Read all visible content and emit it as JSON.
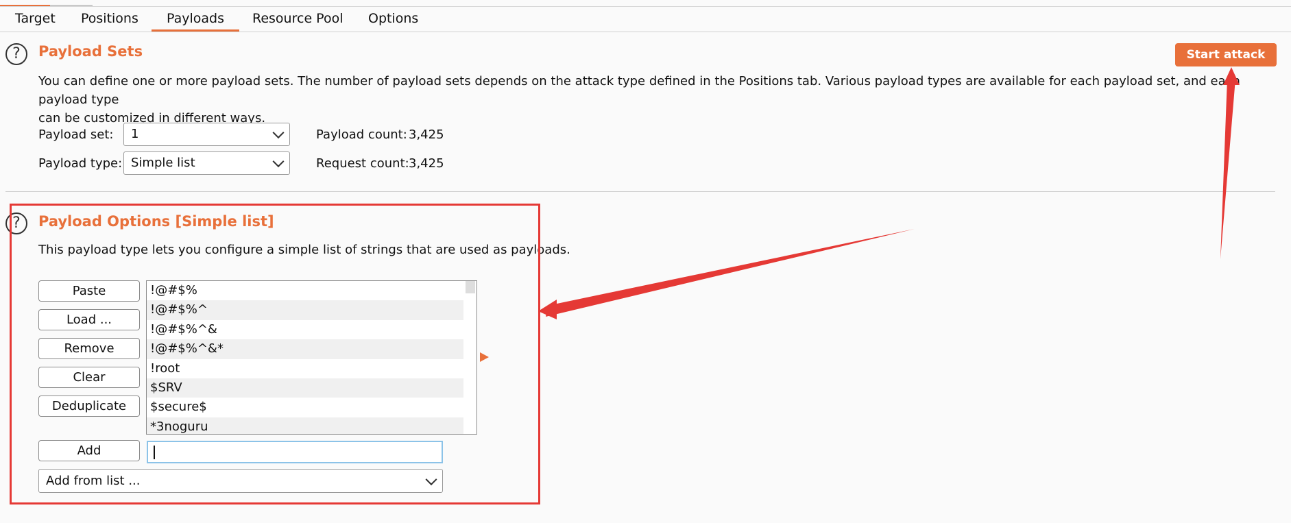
{
  "tabs": [
    "Target",
    "Positions",
    "Payloads",
    "Resource Pool",
    "Options"
  ],
  "active_tab": "Payloads",
  "payload_sets": {
    "title": "Payload Sets",
    "description_line1": "You can define one or more payload sets. The number of payload sets depends on the attack type defined in the Positions tab. Various payload types are available for each payload set, and each payload type",
    "description_line2": "can be customized in different ways.",
    "set_label": "Payload set:",
    "set_value": "1",
    "type_label": "Payload type:",
    "type_value": "Simple list",
    "payload_count_label": "Payload count:",
    "payload_count_value": "3,425",
    "request_count_label": "Request count:",
    "request_count_value": "3,425",
    "start_attack_label": "Start attack"
  },
  "payload_options": {
    "title": "Payload Options [Simple list]",
    "description": "This payload type lets you configure a simple list of strings that are used as payloads.",
    "buttons": {
      "paste": "Paste",
      "load": "Load ...",
      "remove": "Remove",
      "clear": "Clear",
      "deduplicate": "Deduplicate",
      "add": "Add"
    },
    "items": [
      "!@#$%",
      "!@#$%^",
      "!@#$%^&",
      "!@#$%^&*",
      "!root",
      "$SRV",
      "$secure$",
      "*3noguru"
    ],
    "add_input_value": "",
    "add_from_list": "Add from list ..."
  },
  "colors": {
    "accent": "#e8703a",
    "annotation": "#e53935"
  },
  "icons": {
    "help": "help-circle-icon"
  }
}
